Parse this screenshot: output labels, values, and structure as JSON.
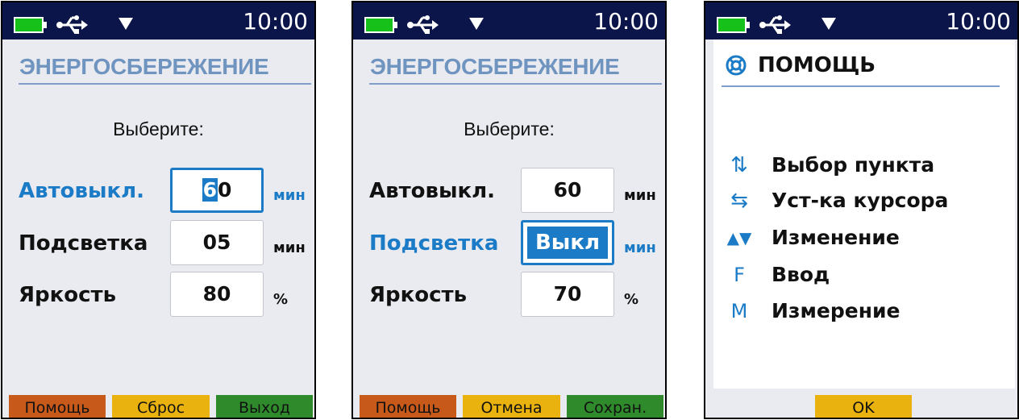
{
  "status": {
    "time": "10:00"
  },
  "colors": {
    "status_bar": "#0b1549",
    "accent": "#1b7bc6",
    "title": "#6f94bf",
    "help_key": "#c75a1a",
    "yellow_key": "#e9b20f",
    "green_key": "#2f8a2c"
  },
  "screen1": {
    "title": "ЭНЕРГОСБЕРЕЖЕНИЕ",
    "prompt": "Выберите:",
    "rows": [
      {
        "label": "Автовыкл.",
        "value_cursor": "6",
        "value_rest": "0",
        "unit": "мин"
      },
      {
        "label": "Подсветка",
        "value": "05",
        "unit": "мин"
      },
      {
        "label": "Яркость",
        "value": "80",
        "unit": "%"
      }
    ],
    "softkeys": [
      "Помощь",
      "Сброс",
      "Выход"
    ]
  },
  "screen2": {
    "title": "ЭНЕРГОСБЕРЕЖЕНИЕ",
    "prompt": "Выберите:",
    "rows": [
      {
        "label": "Автовыкл.",
        "value": "60",
        "unit": "мин"
      },
      {
        "label": "Подсветка",
        "value": "Выкл",
        "unit": "мин"
      },
      {
        "label": "Яркость",
        "value": "70",
        "unit": "%"
      }
    ],
    "softkeys": [
      "Помощь",
      "Отмена",
      "Сохран."
    ]
  },
  "screen3": {
    "title": "ПОМОЩЬ",
    "items": [
      {
        "glyph": "⇅",
        "icon": "up-down-arrows-icon",
        "text": "Выбор пункта"
      },
      {
        "glyph": "⇆",
        "icon": "left-right-arrows-icon",
        "text": "Уст-ка курсора"
      },
      {
        "glyph": "▲▼",
        "icon": "up-down-triangles-icon",
        "text": "Изменение"
      },
      {
        "glyph": "F",
        "icon": "f-key-icon",
        "text": "Ввод"
      },
      {
        "glyph": "M",
        "icon": "m-key-icon",
        "text": "Измерение"
      }
    ],
    "softkey": "OK"
  }
}
